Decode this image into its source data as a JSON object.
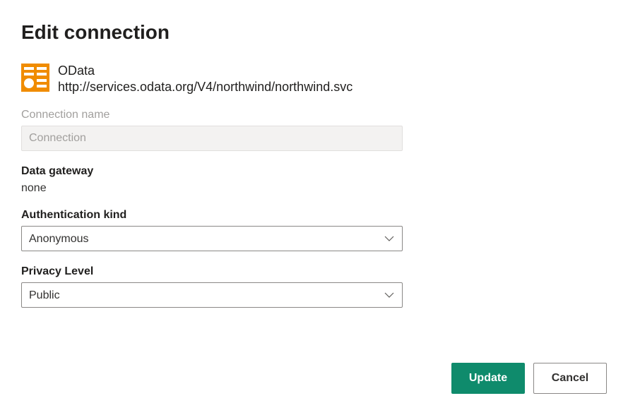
{
  "title": "Edit connection",
  "connection": {
    "type_label": "OData",
    "url": "http://services.odata.org/V4/northwind/northwind.svc",
    "icon_name": "odata-icon",
    "icon_color": "#f08c00"
  },
  "fields": {
    "connection_name": {
      "label": "Connection name",
      "placeholder": "Connection",
      "value": ""
    },
    "data_gateway": {
      "label": "Data gateway",
      "value": "none"
    },
    "authentication_kind": {
      "label": "Authentication kind",
      "selected": "Anonymous"
    },
    "privacy_level": {
      "label": "Privacy Level",
      "selected": "Public"
    }
  },
  "buttons": {
    "update": "Update",
    "cancel": "Cancel"
  }
}
